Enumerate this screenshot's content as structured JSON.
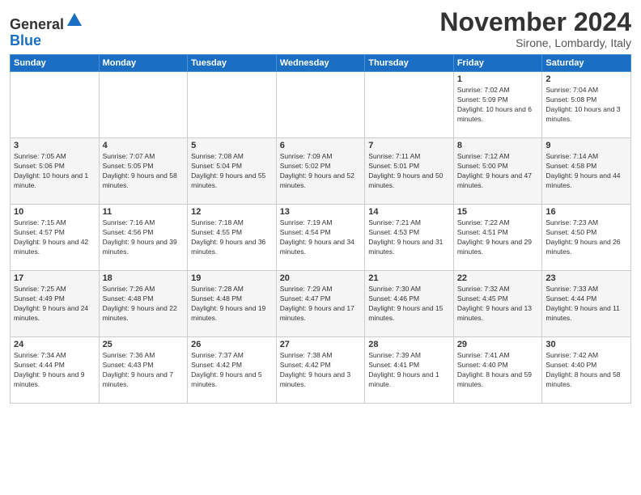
{
  "logo": {
    "general": "General",
    "blue": "Blue"
  },
  "title": "November 2024",
  "location": "Sirone, Lombardy, Italy",
  "days_of_week": [
    "Sunday",
    "Monday",
    "Tuesday",
    "Wednesday",
    "Thursday",
    "Friday",
    "Saturday"
  ],
  "weeks": [
    [
      {
        "day": "",
        "info": ""
      },
      {
        "day": "",
        "info": ""
      },
      {
        "day": "",
        "info": ""
      },
      {
        "day": "",
        "info": ""
      },
      {
        "day": "",
        "info": ""
      },
      {
        "day": "1",
        "info": "Sunrise: 7:02 AM\nSunset: 5:09 PM\nDaylight: 10 hours and 6 minutes."
      },
      {
        "day": "2",
        "info": "Sunrise: 7:04 AM\nSunset: 5:08 PM\nDaylight: 10 hours and 3 minutes."
      }
    ],
    [
      {
        "day": "3",
        "info": "Sunrise: 7:05 AM\nSunset: 5:06 PM\nDaylight: 10 hours and 1 minute."
      },
      {
        "day": "4",
        "info": "Sunrise: 7:07 AM\nSunset: 5:05 PM\nDaylight: 9 hours and 58 minutes."
      },
      {
        "day": "5",
        "info": "Sunrise: 7:08 AM\nSunset: 5:04 PM\nDaylight: 9 hours and 55 minutes."
      },
      {
        "day": "6",
        "info": "Sunrise: 7:09 AM\nSunset: 5:02 PM\nDaylight: 9 hours and 52 minutes."
      },
      {
        "day": "7",
        "info": "Sunrise: 7:11 AM\nSunset: 5:01 PM\nDaylight: 9 hours and 50 minutes."
      },
      {
        "day": "8",
        "info": "Sunrise: 7:12 AM\nSunset: 5:00 PM\nDaylight: 9 hours and 47 minutes."
      },
      {
        "day": "9",
        "info": "Sunrise: 7:14 AM\nSunset: 4:58 PM\nDaylight: 9 hours and 44 minutes."
      }
    ],
    [
      {
        "day": "10",
        "info": "Sunrise: 7:15 AM\nSunset: 4:57 PM\nDaylight: 9 hours and 42 minutes."
      },
      {
        "day": "11",
        "info": "Sunrise: 7:16 AM\nSunset: 4:56 PM\nDaylight: 9 hours and 39 minutes."
      },
      {
        "day": "12",
        "info": "Sunrise: 7:18 AM\nSunset: 4:55 PM\nDaylight: 9 hours and 36 minutes."
      },
      {
        "day": "13",
        "info": "Sunrise: 7:19 AM\nSunset: 4:54 PM\nDaylight: 9 hours and 34 minutes."
      },
      {
        "day": "14",
        "info": "Sunrise: 7:21 AM\nSunset: 4:53 PM\nDaylight: 9 hours and 31 minutes."
      },
      {
        "day": "15",
        "info": "Sunrise: 7:22 AM\nSunset: 4:51 PM\nDaylight: 9 hours and 29 minutes."
      },
      {
        "day": "16",
        "info": "Sunrise: 7:23 AM\nSunset: 4:50 PM\nDaylight: 9 hours and 26 minutes."
      }
    ],
    [
      {
        "day": "17",
        "info": "Sunrise: 7:25 AM\nSunset: 4:49 PM\nDaylight: 9 hours and 24 minutes."
      },
      {
        "day": "18",
        "info": "Sunrise: 7:26 AM\nSunset: 4:48 PM\nDaylight: 9 hours and 22 minutes."
      },
      {
        "day": "19",
        "info": "Sunrise: 7:28 AM\nSunset: 4:48 PM\nDaylight: 9 hours and 19 minutes."
      },
      {
        "day": "20",
        "info": "Sunrise: 7:29 AM\nSunset: 4:47 PM\nDaylight: 9 hours and 17 minutes."
      },
      {
        "day": "21",
        "info": "Sunrise: 7:30 AM\nSunset: 4:46 PM\nDaylight: 9 hours and 15 minutes."
      },
      {
        "day": "22",
        "info": "Sunrise: 7:32 AM\nSunset: 4:45 PM\nDaylight: 9 hours and 13 minutes."
      },
      {
        "day": "23",
        "info": "Sunrise: 7:33 AM\nSunset: 4:44 PM\nDaylight: 9 hours and 11 minutes."
      }
    ],
    [
      {
        "day": "24",
        "info": "Sunrise: 7:34 AM\nSunset: 4:44 PM\nDaylight: 9 hours and 9 minutes."
      },
      {
        "day": "25",
        "info": "Sunrise: 7:36 AM\nSunset: 4:43 PM\nDaylight: 9 hours and 7 minutes."
      },
      {
        "day": "26",
        "info": "Sunrise: 7:37 AM\nSunset: 4:42 PM\nDaylight: 9 hours and 5 minutes."
      },
      {
        "day": "27",
        "info": "Sunrise: 7:38 AM\nSunset: 4:42 PM\nDaylight: 9 hours and 3 minutes."
      },
      {
        "day": "28",
        "info": "Sunrise: 7:39 AM\nSunset: 4:41 PM\nDaylight: 9 hours and 1 minute."
      },
      {
        "day": "29",
        "info": "Sunrise: 7:41 AM\nSunset: 4:40 PM\nDaylight: 8 hours and 59 minutes."
      },
      {
        "day": "30",
        "info": "Sunrise: 7:42 AM\nSunset: 4:40 PM\nDaylight: 8 hours and 58 minutes."
      }
    ]
  ]
}
